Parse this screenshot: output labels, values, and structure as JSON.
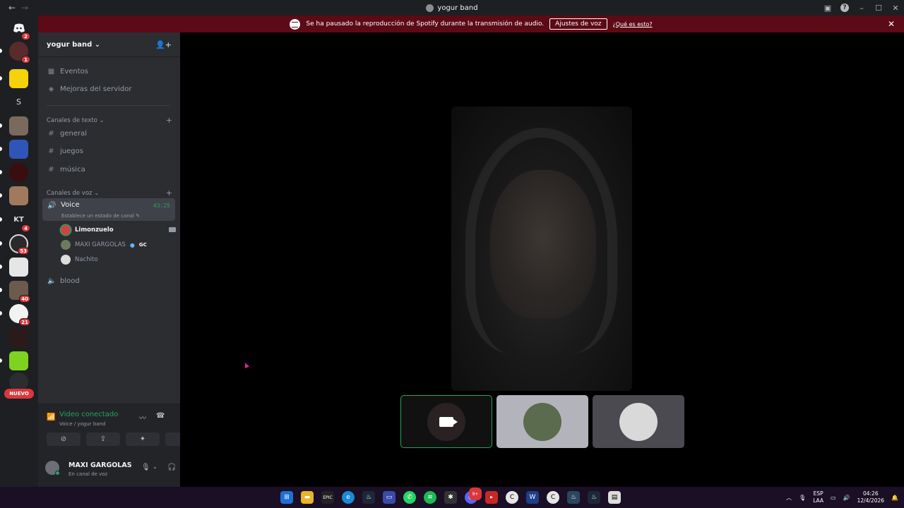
{
  "window": {
    "title": "yogur band"
  },
  "banner": {
    "message": "Se ha pausado la reproducción de Spotify durante la transmisión de audio.",
    "button_label": "Ajustes de voz",
    "link_label": "¿Qué es esto?"
  },
  "rail": {
    "home_badge": "2",
    "servers": [
      {
        "letter": "",
        "badge": "1"
      },
      {
        "letter": "",
        "badge": ""
      },
      {
        "letter": "S",
        "badge": ""
      },
      {
        "letter": "",
        "badge": ""
      },
      {
        "letter": "",
        "badge": ""
      },
      {
        "letter": "",
        "badge": ""
      },
      {
        "letter": "",
        "badge": ""
      },
      {
        "letter": "KT",
        "badge": "4"
      },
      {
        "letter": "",
        "badge": "53"
      },
      {
        "letter": "",
        "badge": ""
      },
      {
        "letter": "",
        "badge": "40"
      },
      {
        "letter": "",
        "badge": "21"
      },
      {
        "letter": "",
        "badge": ""
      },
      {
        "letter": "",
        "badge": ""
      },
      {
        "letter": "",
        "badge": ""
      }
    ],
    "nuevo_label": "NUEVO"
  },
  "sidebar": {
    "server_name": "yogur band",
    "server_chevron": "⌄",
    "links": [
      {
        "label": "Eventos",
        "icon": "calendar-icon"
      },
      {
        "label": "Mejoras del servidor",
        "icon": "boost-icon"
      }
    ],
    "text_category": "Canales de texto",
    "text_channels": [
      "general",
      "juegos",
      "música"
    ],
    "voice_category": "Canales de voz",
    "active_voice": {
      "name": "Voice",
      "time": "43:25",
      "status": "Establece un estado de canal"
    },
    "members": [
      {
        "name": "Limonzuelo",
        "tag": ""
      },
      {
        "name": "MAXI GARGOLAS",
        "tag": "GC"
      },
      {
        "name": "Nachito",
        "tag": ""
      }
    ],
    "other_voice": "blood"
  },
  "voice_panel": {
    "status": "Video conectado",
    "location": "Voice / yogur band"
  },
  "user": {
    "name": "MAXI GARGOLAS",
    "status": "En canal de voz"
  },
  "taskbar": {
    "lang_top": "ESP",
    "lang_bottom": "LAA",
    "time": "04:26",
    "date": "12/4/2026",
    "discord_badge": "9+"
  },
  "colors": {
    "accent_green": "#23a55a",
    "banner_bg": "#5c0a16",
    "badge_red": "#da373c"
  }
}
